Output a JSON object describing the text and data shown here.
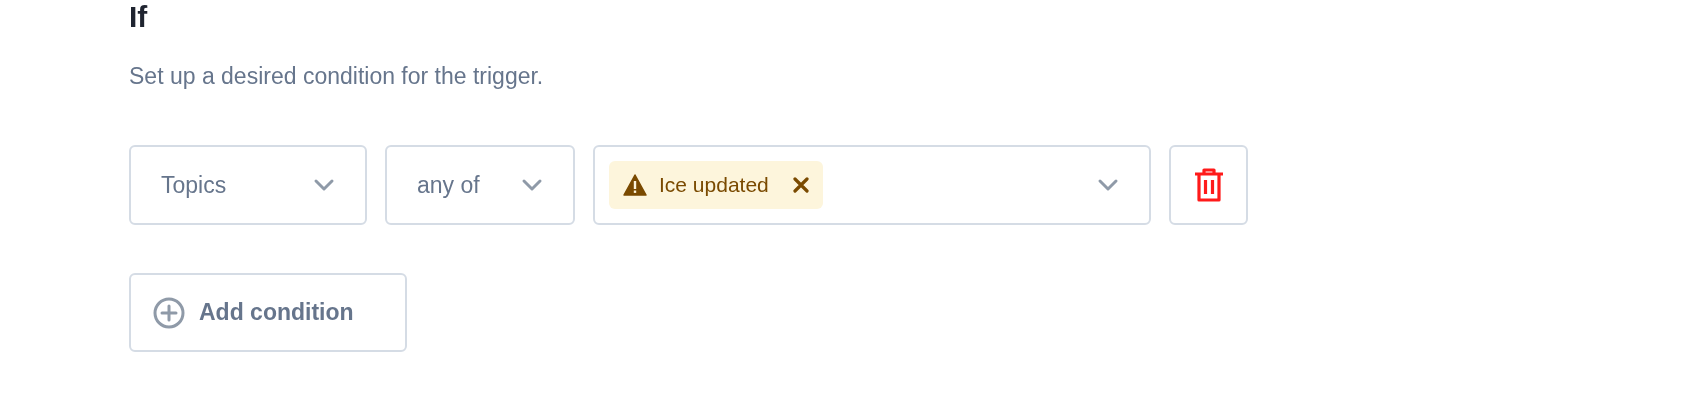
{
  "heading": "If",
  "description": "Set up a desired condition for the trigger.",
  "conditions": [
    {
      "field": "Topics",
      "operator": "any of",
      "values": [
        {
          "label": "Ice updated",
          "kind": "warning"
        }
      ]
    }
  ],
  "add_button": "Add condition"
}
